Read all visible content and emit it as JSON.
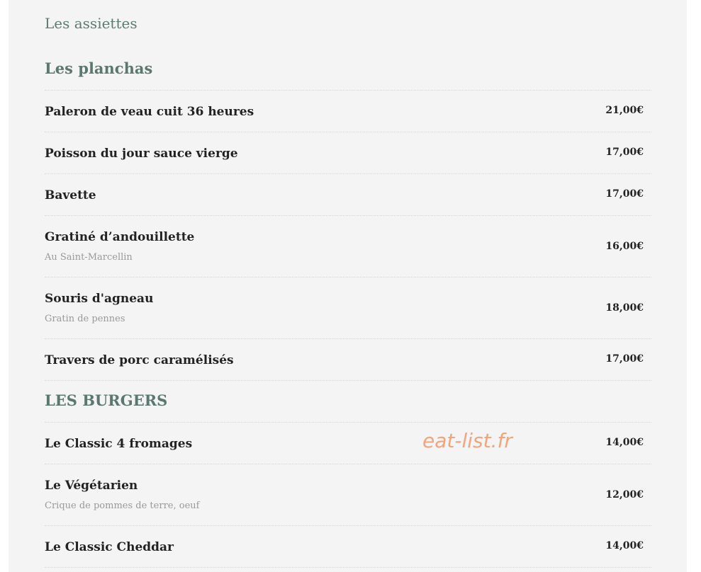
{
  "menu": {
    "category_title": "Les assiettes",
    "sections": [
      {
        "title": "Les planchas",
        "items": [
          {
            "name": "Paleron de veau cuit 36 heures",
            "description": "",
            "price": "21,00€"
          },
          {
            "name": "Poisson du jour sauce vierge",
            "description": "",
            "price": "17,00€"
          },
          {
            "name": "Bavette",
            "description": "",
            "price": "17,00€"
          },
          {
            "name": "Gratiné d’andouillette",
            "description": "Au Saint-Marcellin",
            "price": "16,00€"
          },
          {
            "name": "Souris d'agneau",
            "description": "Gratin de pennes",
            "price": "18,00€"
          },
          {
            "name": "Travers de porc caramélisés",
            "description": "",
            "price": "17,00€"
          }
        ]
      },
      {
        "title": "LES BURGERS",
        "items": [
          {
            "name": "Le Classic 4 fromages",
            "description": "",
            "price": "14,00€"
          },
          {
            "name": "Le Végétarien",
            "description": "Crique de pommes de terre, oeuf",
            "price": "12,00€"
          },
          {
            "name": "Le Classic Cheddar",
            "description": "",
            "price": "14,00€"
          }
        ]
      }
    ]
  },
  "watermark": "eat-list.fr",
  "colors": {
    "heading": "#5a7870",
    "item_text": "#222222",
    "description_text": "#999999",
    "watermark": "#f0a57c",
    "background": "#f4f4f4"
  }
}
